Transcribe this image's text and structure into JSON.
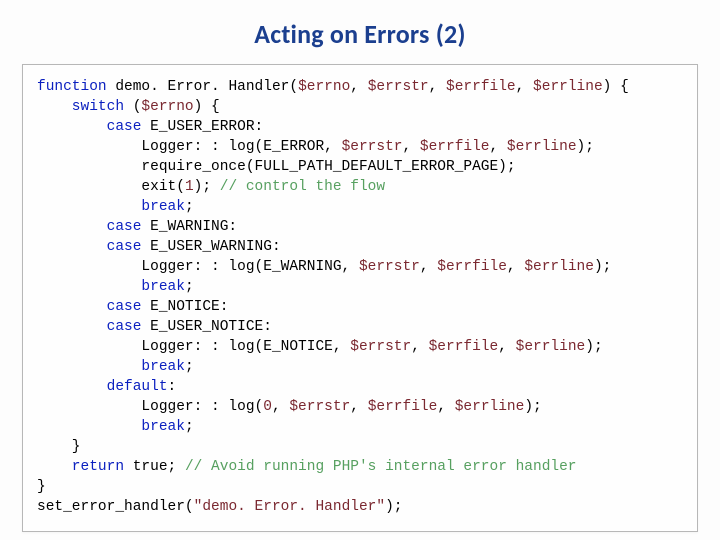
{
  "title": "Acting on Errors (2)",
  "code": {
    "l1a": "function",
    "l1b": " demo. Error. Handler(",
    "l1c": "$errno",
    "l1d": ", ",
    "l1e": "$errstr",
    "l1f": ", ",
    "l1g": "$errfile",
    "l1h": ", ",
    "l1i": "$errline",
    "l1j": ") {",
    "l2a": "    switch",
    "l2b": " (",
    "l2c": "$errno",
    "l2d": ") {",
    "l3a": "        case",
    "l3b": " E_USER_ERROR:",
    "l4a": "            Logger: : log(E_ERROR, ",
    "l4b": "$errstr",
    "l4c": ", ",
    "l4d": "$errfile",
    "l4e": ", ",
    "l4f": "$errline",
    "l4g": ");",
    "l5a": "            require_once(FULL_PATH_DEFAULT_ERROR_PAGE);",
    "l6a": "            exit(",
    "l6b": "1",
    "l6c": "); ",
    "l6d": "// control the flow",
    "l7a": "            break",
    "l7b": ";",
    "l8a": "        case",
    "l8b": " E_WARNING:",
    "l9a": "        case",
    "l9b": " E_USER_WARNING:",
    "l10a": "            Logger: : log(E_WARNING, ",
    "l10b": "$errstr",
    "l10c": ", ",
    "l10d": "$errfile",
    "l10e": ", ",
    "l10f": "$errline",
    "l10g": ");",
    "l11a": "            break",
    "l11b": ";",
    "l12a": "        case",
    "l12b": " E_NOTICE:",
    "l13a": "        case",
    "l13b": " E_USER_NOTICE:",
    "l14a": "            Logger: : log(E_NOTICE, ",
    "l14b": "$errstr",
    "l14c": ", ",
    "l14d": "$errfile",
    "l14e": ", ",
    "l14f": "$errline",
    "l14g": ");",
    "l15a": "            break",
    "l15b": ";",
    "l16a": "        default",
    "l16b": ":",
    "l17a": "            Logger: : log(",
    "l17b": "0",
    "l17c": ", ",
    "l17d": "$errstr",
    "l17e": ", ",
    "l17f": "$errfile",
    "l17g": ", ",
    "l17h": "$errline",
    "l17i": ");",
    "l18a": "            break",
    "l18b": ";",
    "l19": "    }",
    "l20a": "    return",
    "l20b": " true; ",
    "l20c": "// Avoid running PHP's internal error handler",
    "l21": "}",
    "l22a": "set_error_handler(",
    "l22b": "\"demo. Error. Handler\"",
    "l22c": ");"
  }
}
